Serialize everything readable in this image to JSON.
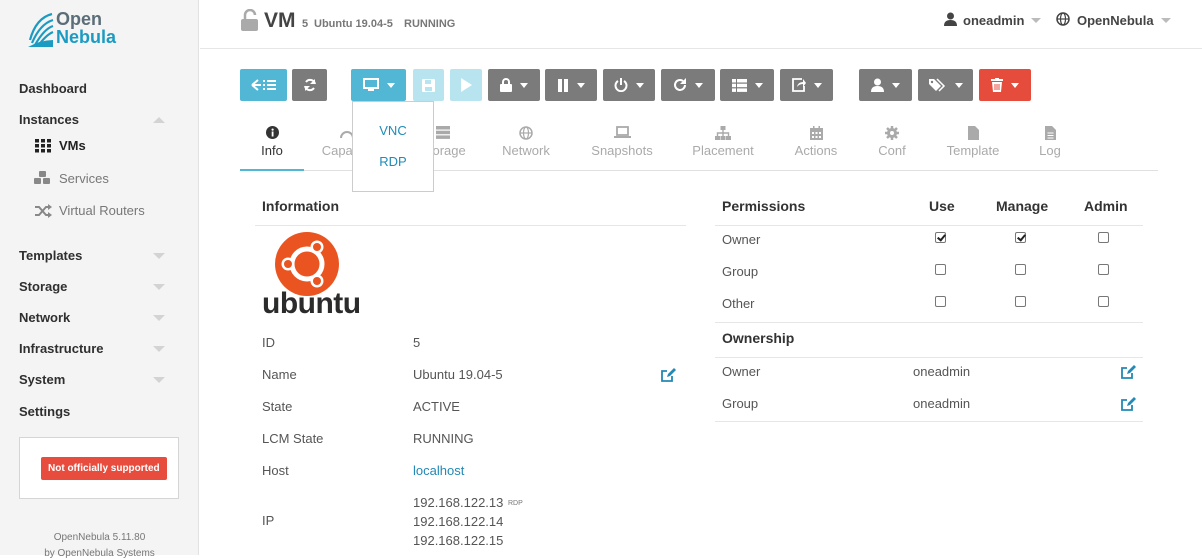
{
  "brand": {
    "line1": "Open",
    "line2": "Nebula"
  },
  "sidebar": {
    "dashboard": "Dashboard",
    "instances": "Instances",
    "vms": "VMs",
    "services": "Services",
    "virtual_routers": "Virtual Routers",
    "templates": "Templates",
    "storage": "Storage",
    "network": "Network",
    "infrastructure": "Infrastructure",
    "system": "System",
    "settings": "Settings",
    "support_label": "Not officially supported",
    "version": "OpenNebula 5.11.80",
    "company": "by OpenNebula Systems"
  },
  "header": {
    "title": "VM",
    "vm_id": "5",
    "vm_name": "Ubuntu 19.04-5",
    "vm_state": "RUNNING",
    "user": "oneadmin",
    "zone": "OpenNebula"
  },
  "dropdown": {
    "vnc": "VNC",
    "rdp": "RDP"
  },
  "tabs": [
    "Info",
    "Capacity",
    "Storage",
    "Network",
    "Snapshots",
    "Placement",
    "Actions",
    "Conf",
    "Template",
    "Log"
  ],
  "info": {
    "title": "Information",
    "os_logo_text": "ubuntu",
    "rows": [
      {
        "key": "ID",
        "value": "5"
      },
      {
        "key": "Name",
        "value": "Ubuntu 19.04-5"
      },
      {
        "key": "State",
        "value": "ACTIVE"
      },
      {
        "key": "LCM State",
        "value": "RUNNING"
      },
      {
        "key": "Host",
        "value": "localhost"
      },
      {
        "key": "IP",
        "value": ""
      }
    ],
    "ips": [
      "192.168.122.13",
      "192.168.122.14",
      "192.168.122.15"
    ],
    "ip_tag": "RDP"
  },
  "permissions": {
    "title": "Permissions",
    "cols": [
      "Use",
      "Manage",
      "Admin"
    ],
    "rows": [
      {
        "label": "Owner",
        "checks": [
          true,
          true,
          false
        ]
      },
      {
        "label": "Group",
        "checks": [
          false,
          false,
          false
        ]
      },
      {
        "label": "Other",
        "checks": [
          false,
          false,
          false
        ]
      }
    ]
  },
  "ownership": {
    "title": "Ownership",
    "owner_label": "Owner",
    "owner": "oneadmin",
    "group_label": "Group",
    "group": "oneadmin"
  },
  "colors": {
    "teal": "#51b7d4",
    "gray": "#7b7b7b",
    "red": "#e64c3c",
    "link": "#2389b5"
  }
}
